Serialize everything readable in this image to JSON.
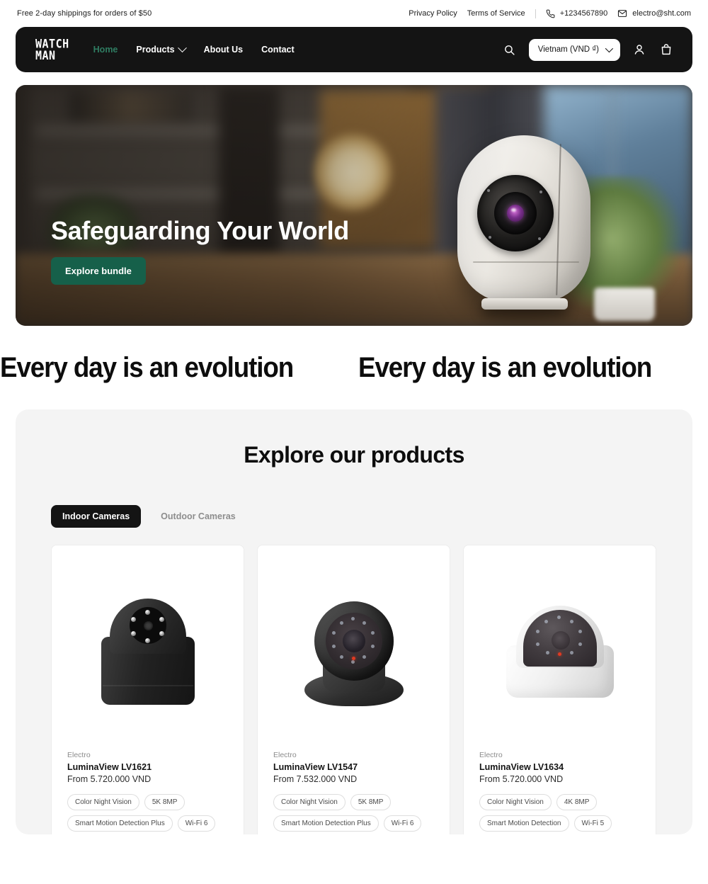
{
  "announcement": {
    "shipping_text": "Free 2-day shippings for orders of $50",
    "links": [
      {
        "label": "Privacy Policy"
      },
      {
        "label": "Terms of Service"
      }
    ],
    "phone": "+1234567890",
    "email": "electro@sht.com",
    "phone_icon": "phone-icon",
    "mail_icon": "mail-icon"
  },
  "header": {
    "logo": "WATCH\nMAN",
    "nav": [
      {
        "label": "Home",
        "active": true
      },
      {
        "label": "Products",
        "has_dropdown": true
      },
      {
        "label": "About Us"
      },
      {
        "label": "Contact"
      }
    ],
    "search_icon": "search-icon",
    "account_icon": "user-icon",
    "cart_icon": "shopping-bag-icon",
    "currency": {
      "selected": "Vietnam (VND ₫)",
      "chevron_icon": "chevron-down-icon"
    },
    "accent_color": "#2f7d62",
    "background_color": "#141414"
  },
  "hero": {
    "title": "Safeguarding Your World",
    "cta_label": "Explore bundle",
    "cta_color": "#16604a"
  },
  "marquee": {
    "text": "Every day is an evolution",
    "repeats": 3
  },
  "products_section": {
    "title": "Explore our products",
    "tabs": [
      {
        "label": "Indoor Cameras",
        "active": true
      },
      {
        "label": "Outdoor Cameras",
        "active": false
      }
    ],
    "cards": [
      {
        "vendor": "Electro",
        "title": "LuminaView LV1621",
        "price": "From 5.720.000 VND",
        "image": "black-dome-camera-on-cylinder",
        "tags": [
          "Color Night Vision",
          "5K 8MP",
          "Smart Motion Detection Plus",
          "Wi-Fi 6"
        ]
      },
      {
        "vendor": "Electro",
        "title": "LuminaView LV1547",
        "price": "From 7.532.000 VND",
        "image": "dark-gray-turret-camera",
        "tags": [
          "Color Night Vision",
          "5K 8MP",
          "Smart Motion Detection Plus",
          "Wi-Fi 6"
        ]
      },
      {
        "vendor": "Electro",
        "title": "LuminaView LV1634",
        "price": "From 5.720.000 VND",
        "image": "white-dome-camera",
        "tags": [
          "Color Night Vision",
          "4K 8MP",
          "Smart Motion Detection",
          "Wi-Fi 5"
        ]
      }
    ],
    "background_color": "#f4f4f4"
  }
}
